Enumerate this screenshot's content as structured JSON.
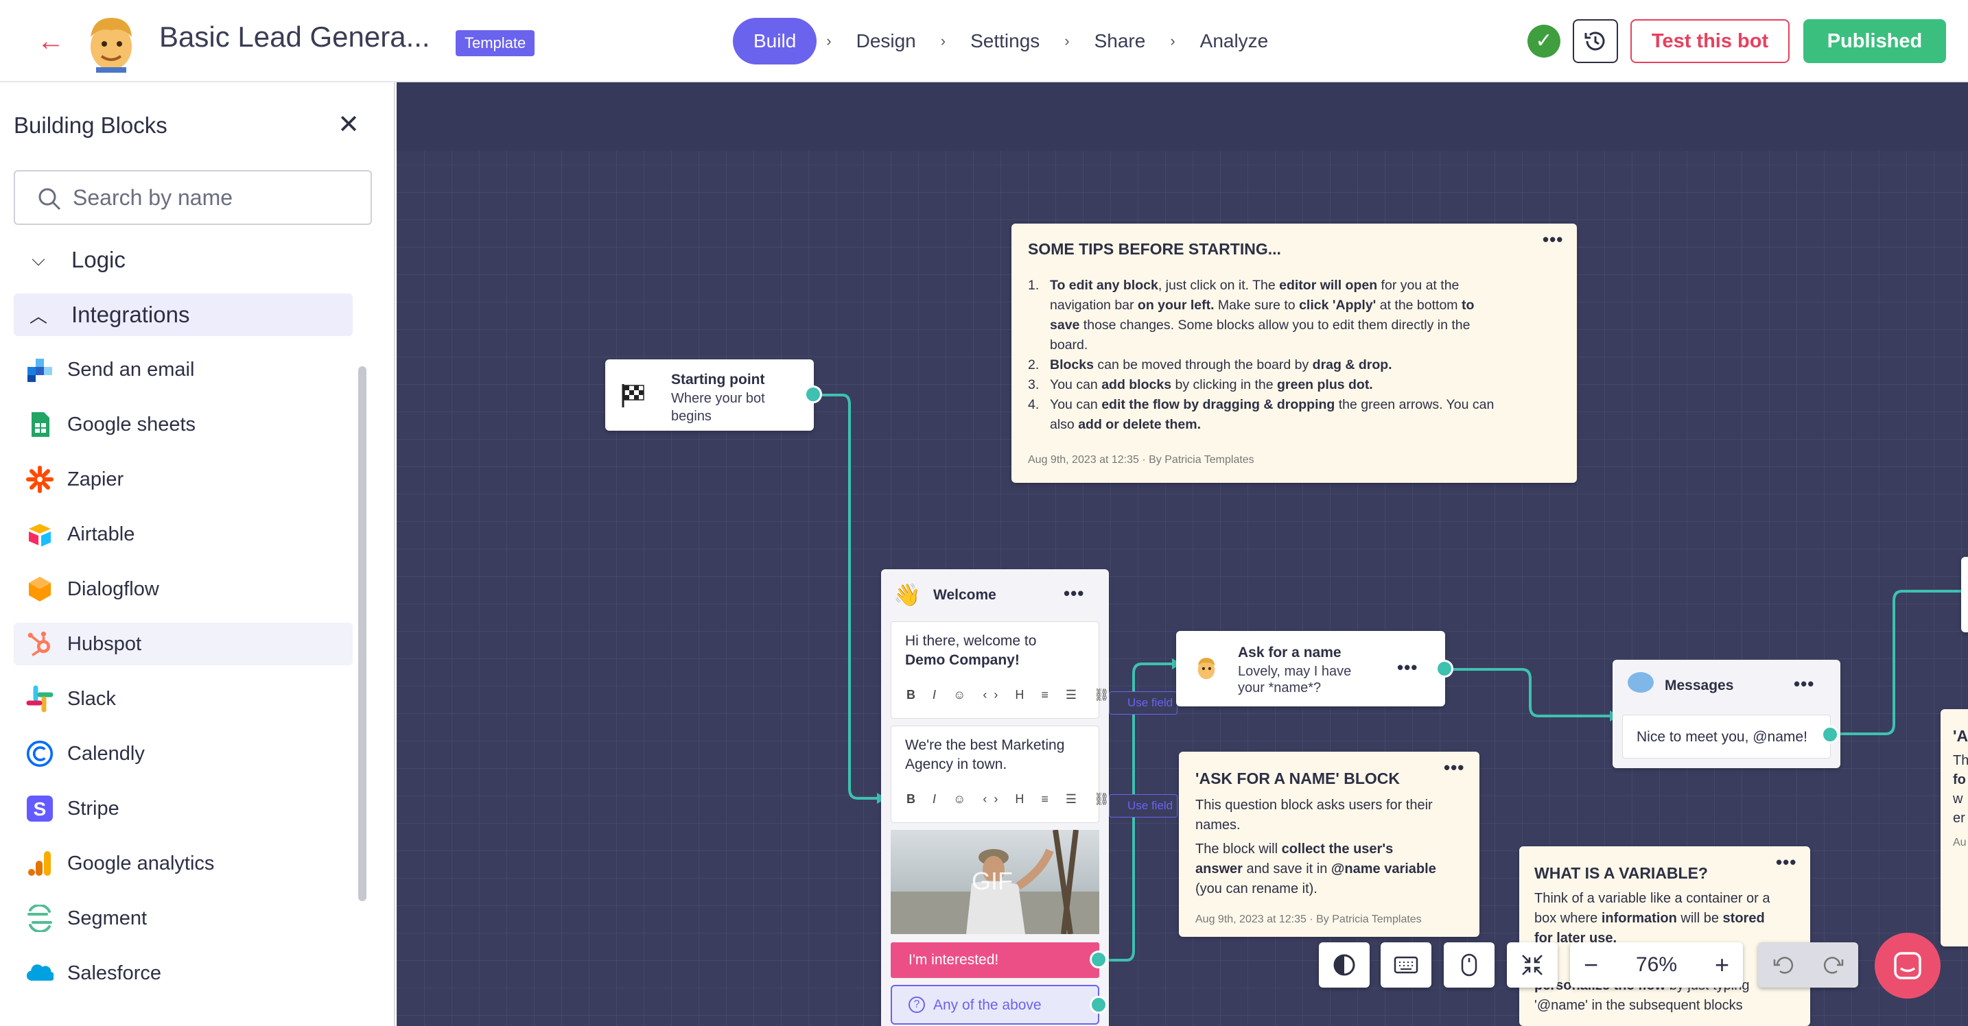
{
  "header": {
    "title": "Basic Lead Genera...",
    "badge": "Template",
    "steps": [
      "Build",
      "Design",
      "Settings",
      "Share",
      "Analyze"
    ],
    "active_step": "Build",
    "test_label": "Test this bot",
    "published_label": "Published"
  },
  "sidebar": {
    "title": "Building Blocks",
    "search_placeholder": "Search by name",
    "groups": {
      "logic": "Logic",
      "integrations": "Integrations"
    },
    "items": [
      "Send an email",
      "Google sheets",
      "Zapier",
      "Airtable",
      "Dialogflow",
      "Hubspot",
      "Slack",
      "Calendly",
      "Stripe",
      "Google analytics",
      "Segment",
      "Salesforce"
    ]
  },
  "canvas": {
    "tips": {
      "title": "SOME TIPS BEFORE STARTING...",
      "l1a": "To edit any block",
      "l1b": ", just click on it. The ",
      "l1c": "editor will open",
      "l1d": " for you at the",
      "l1e": "navigation bar ",
      "l1f": "on your left.",
      "l1g": " Make sure to ",
      "l1h": "click 'Apply'",
      "l1i": " at the bottom ",
      "l1j": "to",
      "l1k": "save",
      "l1l": " those changes. Some blocks allow you to edit them directly in the",
      "l1m": "board.",
      "l2a": "Blocks",
      "l2b": " can be moved through the board by ",
      "l2c": "drag & drop.",
      "l3a": "You can ",
      "l3b": "add blocks",
      "l3c": " by clicking in the ",
      "l3d": "green plus dot.",
      "l4a": "You can ",
      "l4b": "edit the flow by dragging & dropping",
      "l4c": " the green arrows. You can",
      "l4d": "also ",
      "l4e": "add or delete them.",
      "footer": "Aug 9th, 2023 at 12:35 · By Patricia Templates"
    },
    "start": {
      "title": "Starting point",
      "sub1": "Where your bot",
      "sub2": "begins"
    },
    "welcome": {
      "title": "Welcome",
      "msg1a": "Hi there, welcome to",
      "msg1b": "Demo Company!",
      "msg2a": "We're the best Marketing",
      "msg2b": "Agency in town.",
      "gif": "GIF",
      "btn1": "I'm interested!",
      "btn2": "Any of the above",
      "use_field": "Use field"
    },
    "ask": {
      "title": "Ask for a name",
      "sub1": "Lovely, may I have",
      "sub2": "your *name*?"
    },
    "asknote": {
      "title": "'ASK FOR A NAME' BLOCK",
      "p1a": "This question block asks users for their",
      "p1b": "names.",
      "p2a": "The block will ",
      "p2b": "collect the user's",
      "p2c": "answer",
      "p2d": " and save it in ",
      "p2e": "@name variable",
      "p2f": "(you can rename it).",
      "footer": "Aug 9th, 2023 at 12:35 · By Patricia Templates"
    },
    "messages": {
      "title": "Messages",
      "msg": "Nice to meet you, @name!"
    },
    "varnote": {
      "title": "WHAT IS A VARIABLE?",
      "p1a": "Think of a variable like a container or a",
      "p1b": "box where ",
      "p1c": "information",
      "p1d": " will be ",
      "p1e": "stored",
      "p1f": "for later use.",
      "p2a": "personalize the flow",
      "p2b": " by just typing",
      "p2c": "'@name' in the subsequent blocks"
    },
    "edge_note": {
      "l1": "'A",
      "l2": "Th",
      "l3": "fo",
      "l4": "w",
      "l5": "er",
      "l6": "Au"
    },
    "zoom": "76%"
  },
  "colors": {
    "accent": "#6a63ee",
    "danger": "#e8405e",
    "success": "#3bbf7f",
    "canvas": "#3a3d5e",
    "port": "#3ec1b0",
    "pink": "#ec4f86"
  }
}
